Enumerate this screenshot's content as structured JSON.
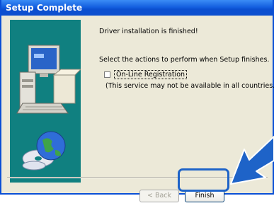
{
  "window": {
    "title": "Setup Complete"
  },
  "main": {
    "message": "Driver installation is finished!",
    "instruction": "Select the actions to perform when Setup finishes.",
    "checkbox": {
      "label": "On-Line Registration",
      "checked": false
    },
    "note": "(This service may not be available in all countries.)"
  },
  "buttons": {
    "back_label": "< Back",
    "finish_label": "Finish"
  },
  "colors": {
    "titlebar": "#0b4fd0",
    "panel": "#108080",
    "arrow": "#1e63c8"
  },
  "icons": [
    "computer-illustration",
    "cd-globe-icon",
    "pointer-arrow"
  ]
}
